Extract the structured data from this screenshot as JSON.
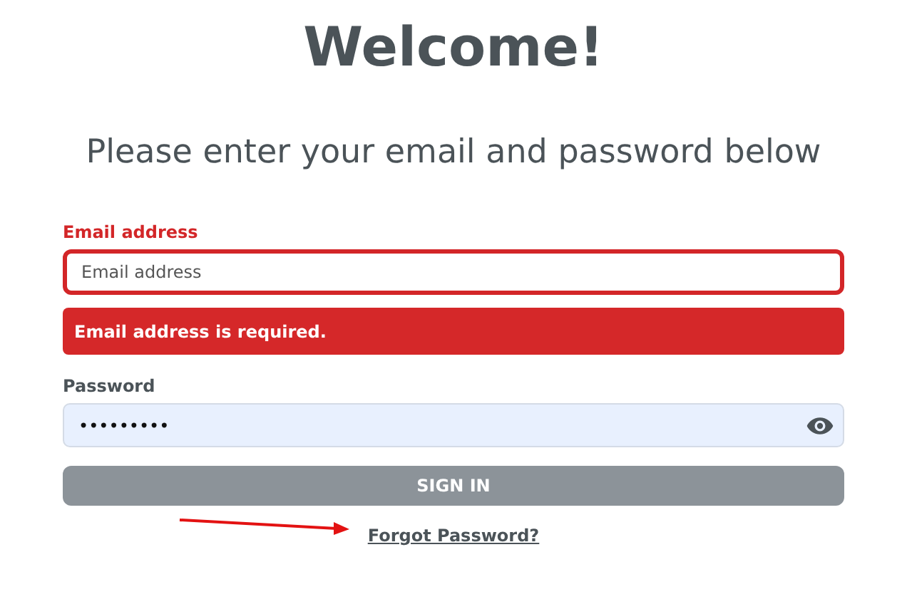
{
  "title": "Welcome!",
  "subtitle": "Please enter your email and password below",
  "email": {
    "label": "Email address",
    "placeholder": "Email address",
    "error": true,
    "error_message": "Email address is required."
  },
  "password": {
    "label": "Password",
    "value": "•••••••••",
    "error": false
  },
  "sign_in": {
    "label": "SIGN IN",
    "disabled": true
  },
  "forgot_link": "Forgot Password?"
}
